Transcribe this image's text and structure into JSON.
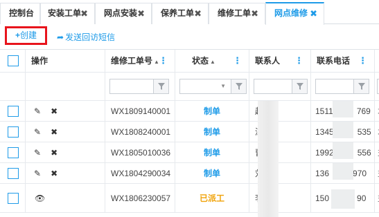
{
  "tabs": [
    {
      "label": "控制台",
      "closable": false,
      "active": false
    },
    {
      "label": "安装工单",
      "closable": true,
      "active": false
    },
    {
      "label": "网点安装",
      "closable": true,
      "active": false
    },
    {
      "label": "保养工单",
      "closable": true,
      "active": false
    },
    {
      "label": "维修工单",
      "closable": true,
      "active": false
    },
    {
      "label": "网点维修",
      "closable": true,
      "active": true
    }
  ],
  "tab_close_glyph": "✖",
  "toolbar": {
    "create_plus": "+",
    "create_label": "创建",
    "sms_label": "发送回访短信"
  },
  "grid": {
    "headers": {
      "operation": "操作",
      "order_no": "维修工单号",
      "status": "状态",
      "contact": "联系人",
      "phone": "联系电话"
    },
    "rows": [
      {
        "order_no": "WX1809140001",
        "status": "制单",
        "phone_prefix": "1511",
        "phone_suffix": "769",
        "contact_char": "赵",
        "extra": "才",
        "editable": true
      },
      {
        "order_no": "WX1808240001",
        "status": "制单",
        "phone_prefix": "1345",
        "phone_suffix": "535",
        "contact_char": "深",
        "extra": "才",
        "editable": true
      },
      {
        "order_no": "WX1805010036",
        "status": "制单",
        "phone_prefix": "1992",
        "phone_suffix": "556",
        "contact_char": "曹",
        "extra": "益",
        "editable": true
      },
      {
        "order_no": "WX1804290034",
        "status": "制单",
        "phone_prefix": "136",
        "phone_suffix": "970",
        "contact_char": "刘",
        "extra": "益",
        "editable": true
      },
      {
        "order_no": "WX1806230057",
        "status": "已派工",
        "phone_prefix": "150",
        "phone_suffix": "90",
        "contact_char": "李",
        "extra": "益",
        "editable": false
      }
    ]
  },
  "colors": {
    "accent": "#1e9be8",
    "highlight_border": "#e8141c",
    "status_dispatched": "#f0a30a"
  }
}
